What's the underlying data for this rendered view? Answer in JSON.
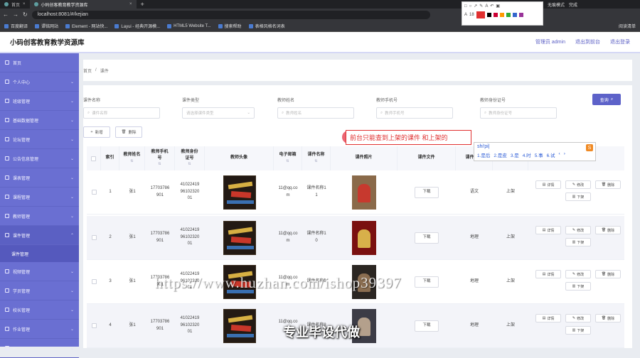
{
  "browser": {
    "tabs": [
      {
        "label": "首页"
      },
      {
        "label": "小码创客教育教学资源库"
      }
    ],
    "new_tab": "+",
    "url": "localhost:8081/#/kejian",
    "bookmarks": [
      "百度翻译",
      "谭铭网站",
      "Element - 网站快...",
      "Layui - 经典开源模...",
      "HTML5 Website T...",
      "搜索帮助",
      "表格风格名词表"
    ],
    "bookmarks_right": "阅读清单",
    "sys": [
      "无痕模式",
      "完成"
    ]
  },
  "screenshot_tool": {
    "font_size": "18"
  },
  "header": {
    "title": "小码创客教育教学资源库",
    "admin": "管理员 admin",
    "back_to_front": "退出到前台",
    "logout": "退出登录"
  },
  "sidebar": {
    "items": [
      {
        "label": "首页",
        "chevron": false
      },
      {
        "label": "个人中心",
        "chevron": true
      },
      {
        "label": "班级管理",
        "chevron": true
      },
      {
        "label": "基础数据管理",
        "chevron": true
      },
      {
        "label": "论坛管理",
        "chevron": true
      },
      {
        "label": "公告信息管理",
        "chevron": true
      },
      {
        "label": "课表管理",
        "chevron": true
      },
      {
        "label": "课程管理",
        "chevron": true
      },
      {
        "label": "教师管理",
        "chevron": true
      },
      {
        "label": "课件管理",
        "chevron": true,
        "expanded": true
      },
      {
        "label": "视频管理",
        "chevron": true
      },
      {
        "label": "学员管理",
        "chevron": true
      },
      {
        "label": "校长管理",
        "chevron": true
      },
      {
        "label": "作业管理",
        "chevron": true
      },
      {
        "label": "...",
        "chevron": true
      }
    ],
    "sub_item": "课件管理"
  },
  "breadcrumb": {
    "home": "首页",
    "sep": "/",
    "current": "课件"
  },
  "search": {
    "fields": [
      {
        "label": "课件名称",
        "placeholder": "课件名称"
      },
      {
        "label": "课件类型",
        "placeholder": "请选择课件类型"
      },
      {
        "label": "教师姓名",
        "placeholder": "教师姓名"
      },
      {
        "label": "教师手机号",
        "placeholder": "教师手机号"
      },
      {
        "label": "教师身份证号",
        "placeholder": "教师身份证号"
      }
    ],
    "query_button": "查询",
    "add_button": "新增",
    "delete_button": "删除"
  },
  "table": {
    "headers": [
      "索引",
      "教师姓名",
      "教师手机号",
      "教师身份证号",
      "教师头像",
      "电子邮箱",
      "课件名称",
      "课件照片",
      "课件文件",
      "课件类型",
      "",
      "操作"
    ],
    "rows": [
      {
        "index": "1",
        "teacher": "张1",
        "phone": "17703786901",
        "idcard": "410224199610232001",
        "email": "11@qq.com",
        "name": "课件名称11",
        "type": "语文",
        "status": "上架"
      },
      {
        "index": "2",
        "teacher": "张1",
        "phone": "17703786901",
        "idcard": "410224199610232001",
        "email": "11@qq.com",
        "name": "课件名称10",
        "type": "地理",
        "status": "上架"
      },
      {
        "index": "3",
        "teacher": "张1",
        "phone": "17703786901",
        "idcard": "410224199610232001",
        "email": "11@qq.com",
        "name": "课件名称9",
        "type": "地理",
        "status": "上架"
      },
      {
        "index": "4",
        "teacher": "张1",
        "phone": "17703786901",
        "idcard": "410224199610232001",
        "email": "11@qq.com",
        "name": "课件名称8",
        "type": "地理",
        "status": "上架"
      }
    ],
    "download_label": "下载",
    "actions": [
      "详情",
      "修改",
      "删除",
      "下架"
    ]
  },
  "annotation": {
    "text": "前台只能查到上架的课件 和上架的"
  },
  "ime": {
    "pinyin": "shi'pi|",
    "candidates": [
      "1.是后",
      "2.是皮",
      "3.是",
      "4.时",
      "5.事",
      "6.试",
      "‹",
      "›"
    ]
  },
  "watermark": "https://www.huzhan.com/ishop39397",
  "caption": "专业毕设代做",
  "colors": {
    "accent": "#5d62c9",
    "sidebar": "#6a6fd2",
    "annotation": "#e03030"
  }
}
